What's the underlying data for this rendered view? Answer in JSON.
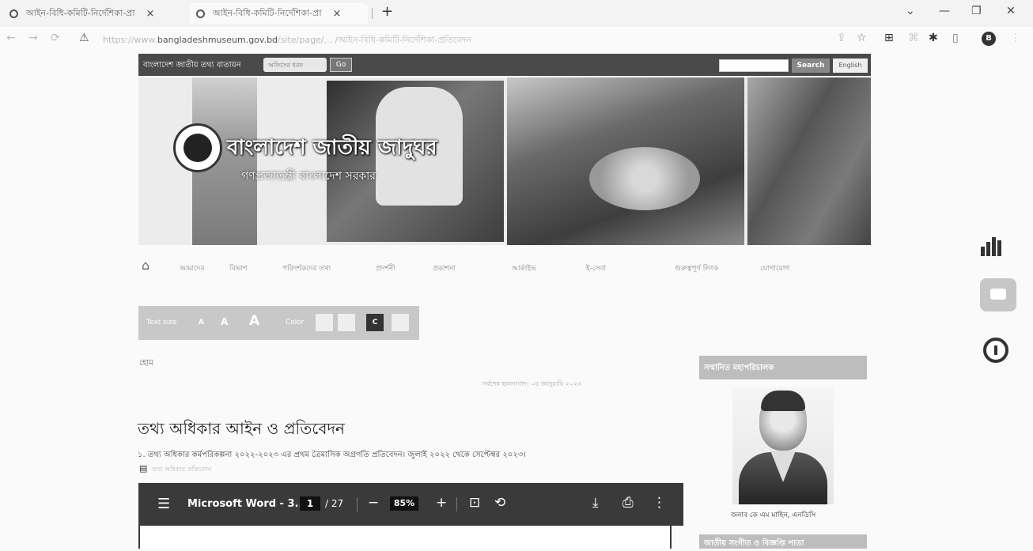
{
  "browser": {
    "tabs": [
      {
        "title": "আইন-বিধি-কমিটি-নির্দেশিকা-প্রা"
      },
      {
        "title": "আইন-বিধি-কমিটি-নির্দেশিকা-প্রা"
      }
    ],
    "url_prefix": "https://www.",
    "url_domain": "bangladeshmuseum.gov.bd",
    "url_rest": "/site/page/... /আইন-বিধি-কমিটি-নির্দেশিকা-প্রতিবেদন",
    "profile_initial": "B"
  },
  "site": {
    "brand": "বাংলাদেশ জাতীয় তথ্য বাতায়ন",
    "select_placeholder": "অফিসের ধরন",
    "go": "Go",
    "search_btn": "Search",
    "english_btn": "English"
  },
  "banner": {
    "title": "বাংলাদেশ জাতীয় জাদুঘর",
    "subtitle": "গণপ্রজাতন্ত্রী বাংলাদেশ সরকার"
  },
  "nav": [
    "আমাদের",
    "বিভাগ",
    "পরিদর্শকদের তথ্য",
    "প্রদর্শনী",
    "প্রকাশনা",
    "আর্কাইভ",
    "ই-সেবা",
    "গুরুত্বপূর্ণ লিংক",
    "যোগাযোগ"
  ],
  "accessibility": {
    "text_size": "Text size",
    "a_small": "A",
    "a_mid": "A",
    "a_large": "A",
    "color": "Color",
    "swatches": [
      "",
      "",
      "C",
      ""
    ]
  },
  "breadcrumb": "হোম",
  "last_updated": "সর্বশেষ হালনাগাদ: ০৫ জানুয়ারি ২০২৩",
  "page_title": "তথ্য অধিকার আইন ও প্রতিবেদন",
  "item1": "১. তথ্য অধিকার কর্মপরিকল্পনা ২০২২-২০২৩ এর প্রথম ত্রৈমাসিক অগ্রগতি প্রতিবেদন। জুলাই ২০২২ থেকে সেপ্টেম্বর ২০২৩।",
  "item1_file": "তথ্য অধিকার প্রতিবেদন",
  "pdf": {
    "title": "Microsoft Word - 3...",
    "page": "1",
    "total": "/ 27",
    "zoom": "85%"
  },
  "sidebar": {
    "heading": "সম্মানিত মহাপরিচালক",
    "caption": "জনাব কে এম মাহিন, এনডিসি",
    "heading2": "জাতীয় সংগীত ও বিজ্ঞপ্তি পাতা"
  }
}
